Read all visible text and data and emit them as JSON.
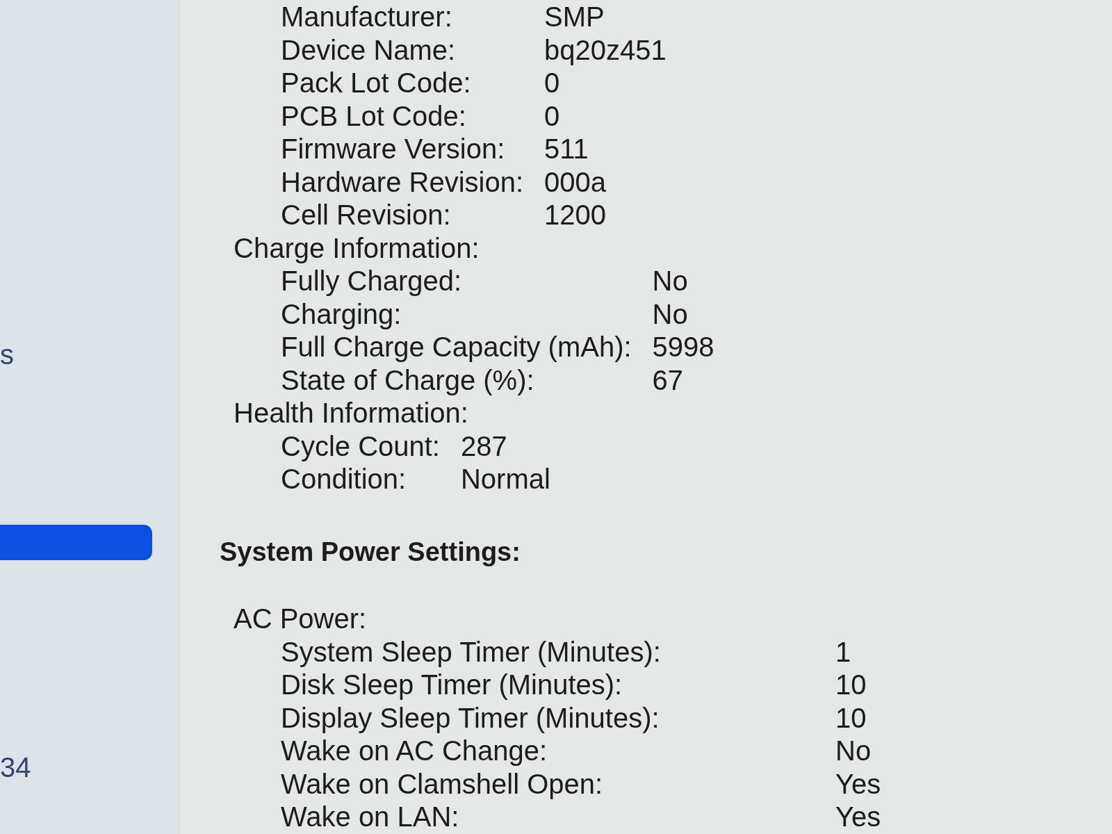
{
  "sidebar": {
    "items": [
      {
        "text": "s",
        "selected": false
      },
      {
        "selected": true
      },
      {
        "text": "34",
        "selected": false
      }
    ]
  },
  "content": {
    "sections": [
      {
        "groups": [
          {
            "rows": [
              {
                "label": "Manufacturer:",
                "value": "SMP"
              },
              {
                "label": "Device Name:",
                "value": "bq20z451"
              },
              {
                "label": "Pack Lot Code:",
                "value": "0"
              },
              {
                "label": "PCB Lot Code:",
                "value": "0"
              },
              {
                "label": "Firmware Version:",
                "value": "511"
              },
              {
                "label": "Hardware Revision:",
                "value": "000a"
              },
              {
                "label": "Cell Revision:",
                "value": "1200"
              }
            ]
          },
          {
            "heading": "Charge Information:",
            "rows": [
              {
                "label": "Fully Charged:",
                "value": "No"
              },
              {
                "label": "Charging:",
                "value": "No"
              },
              {
                "label": "Full Charge Capacity (mAh):",
                "value": "5998"
              },
              {
                "label": "State of Charge (%):",
                "value": "67"
              }
            ]
          },
          {
            "heading": "Health Information:",
            "rows": [
              {
                "label": "Cycle Count:",
                "value": "287"
              },
              {
                "label": "Condition:",
                "value": "Normal"
              }
            ]
          }
        ]
      },
      {
        "title": "System Power Settings:",
        "groups": [
          {
            "heading": "AC Power:",
            "rows": [
              {
                "label": "System Sleep Timer (Minutes):",
                "value": "1"
              },
              {
                "label": "Disk Sleep Timer (Minutes):",
                "value": "10"
              },
              {
                "label": "Display Sleep Timer (Minutes):",
                "value": "10"
              },
              {
                "label": "Wake on AC Change:",
                "value": "No"
              },
              {
                "label": "Wake on Clamshell Open:",
                "value": "Yes"
              },
              {
                "label": "Wake on LAN:",
                "value": "Yes"
              }
            ]
          }
        ]
      }
    ]
  }
}
